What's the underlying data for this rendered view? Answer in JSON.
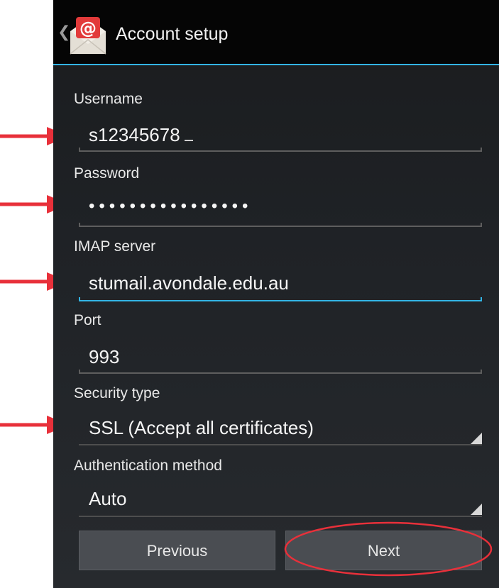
{
  "header": {
    "title": "Account setup",
    "back_glyph": "❮",
    "app_icon": "email-app-icon"
  },
  "form": {
    "username": {
      "label": "Username",
      "value": "s12345678"
    },
    "password": {
      "label": "Password",
      "value": "••••••••••••••••"
    },
    "imap_server": {
      "label": "IMAP server",
      "value": "stumail.avondale.edu.au"
    },
    "port": {
      "label": "Port",
      "value": "993"
    },
    "security_type": {
      "label": "Security type",
      "value": "SSL (Accept all certificates)"
    },
    "auth_method": {
      "label": "Authentication method",
      "value": "Auto"
    }
  },
  "buttons": {
    "previous": "Previous",
    "next": "Next"
  },
  "colors": {
    "accent": "#33b5e5",
    "annotation": "#e8303a",
    "background": "#1f2226",
    "actionbar": "#050505"
  }
}
